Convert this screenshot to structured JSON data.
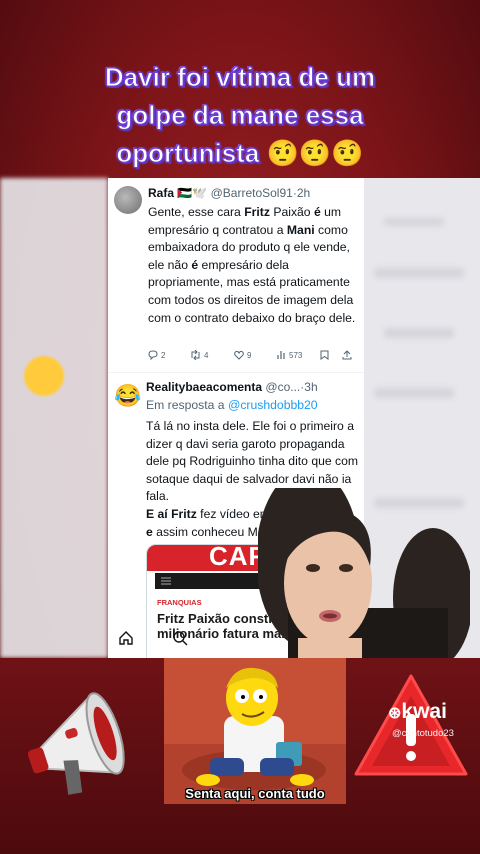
{
  "caption": {
    "line1": "Davir foi vítima de um",
    "line2": "golpe da mane essa",
    "line3": "oportunista",
    "emojis": "🤨🤨🤨"
  },
  "tweet1": {
    "name": "Rafa",
    "flags": "🇵🇸🕊️",
    "handle": "@BarretoSol91",
    "time": "2h",
    "text_parts": {
      "p1": "Gente, esse cara ",
      "b1": "Fritz",
      "p2": " Paixão ",
      "b2": "é",
      "p3": " um empresário q contratou a ",
      "b3": "Mani",
      "p4": " como embaixadora do produto q ele vende, ele não ",
      "b4": "é",
      "p5": " empresário dela propriamente, mas está praticamente com todos os direitos de imagem dela com o contrato debaixo do braço dele."
    },
    "replies": "2",
    "retweets": "4",
    "likes": "9",
    "views": "573"
  },
  "tweet2": {
    "avatar_emoji": "😂",
    "name": "Realitybaeacomenta",
    "handle": "@co...",
    "time": "3h",
    "reply_prefix": "Em resposta a ",
    "reply_handle": "@crushdobbb20",
    "text_parts": {
      "p1": "Tá lá no insta dele. Ele foi o primeiro a dizer q davi seria garoto propaganda dele pq Rodriguinho tinha dito que com sotaque daqui de salvador davi não ia fa",
      "p2": "la.",
      "b1": "E aí Fritz",
      "p3": " fez vídeo em",
      "b2": "e",
      "p4": " assim conheceu M"
    },
    "card": {
      "banner": "CAR",
      "tag": "FRANQUIAS",
      "title": "Fritz Paixão constr negócio milionário fatura mais d"
    }
  },
  "meme": {
    "caption": "Senta aqui, conta tudo"
  },
  "watermark": {
    "brand": "kwai",
    "handle": "@contotudo23"
  },
  "colors": {
    "background": "#7a1418",
    "caption_outline": "#6b3fd6",
    "link": "#1d9bf0",
    "warning": "#e8272b"
  }
}
